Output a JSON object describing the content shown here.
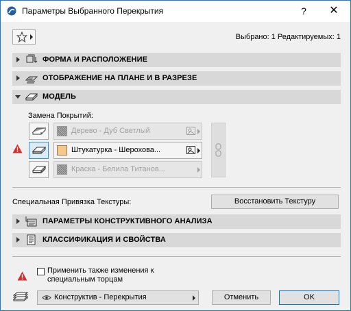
{
  "window": {
    "title": "Параметры Выбранного Перекрытия",
    "help_glyph": "?",
    "close_glyph": "✕"
  },
  "toolbar": {
    "favorites_icon": "star-icon",
    "selection_info": "Выбрано: 1 Редактируемых: 1"
  },
  "sections": [
    {
      "label": "ФОРМА И РАСПОЛОЖЕНИЕ",
      "expanded": false
    },
    {
      "label": "ОТОБРАЖЕНИЕ НА ПЛАНЕ И В РАЗРЕЗЕ",
      "expanded": false
    },
    {
      "label": "МОДЕЛЬ",
      "expanded": true
    },
    {
      "label": "ПАРАМЕТРЫ КОНСТРУКТИВНОГО АНАЛИЗА",
      "expanded": false
    },
    {
      "label": "КЛАССИФИКАЦИЯ И СВОЙСТВА",
      "expanded": false
    }
  ],
  "model": {
    "override_label": "Замена Покрытий:",
    "surfaces": [
      {
        "name": "Дерево - Дуб Светлый",
        "enabled": false
      },
      {
        "name": "Штукатурка - Шерохова...",
        "enabled": true,
        "swatch_color": "#f5c98b"
      },
      {
        "name": "Краска - Белила Титанов...",
        "enabled": false
      }
    ],
    "texture_label": "Специальная Привязка Текстуры:",
    "restore_texture_button": "Восстановить Текстуру"
  },
  "footer": {
    "apply_checkbox_label": "Применить также изменения к специальным торцам",
    "apply_checked": false,
    "layer_value": "Конструктив - Перекрытия",
    "cancel_button": "Отменить",
    "ok_button": "OK"
  },
  "colors": {
    "accent": "#1a7ad4",
    "section_bg": "#d8d8d8",
    "warning": "#d32f2f"
  }
}
